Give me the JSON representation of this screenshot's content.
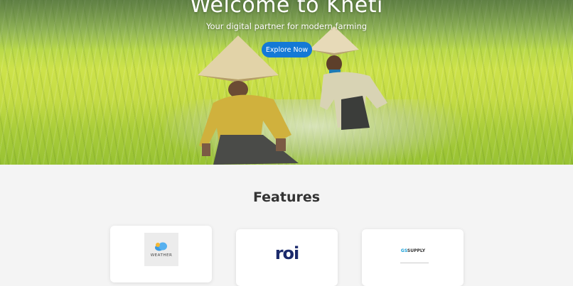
{
  "hero": {
    "title": "Welcome to Kheti",
    "subtitle": "Your digital partner for modern farming",
    "cta_label": "Explore Now"
  },
  "features": {
    "heading": "Features",
    "cards": [
      {
        "logo_text": "WEATHER",
        "icon": "cloud-icon"
      },
      {
        "logo_text": "roi"
      },
      {
        "logo_text_prefix": "GS",
        "logo_text_suffix": "SUPPLY"
      }
    ]
  },
  "colors": {
    "primary": "#1479d6",
    "background": "#f4f4f4",
    "card": "#ffffff",
    "roi": "#1b2a6b"
  }
}
